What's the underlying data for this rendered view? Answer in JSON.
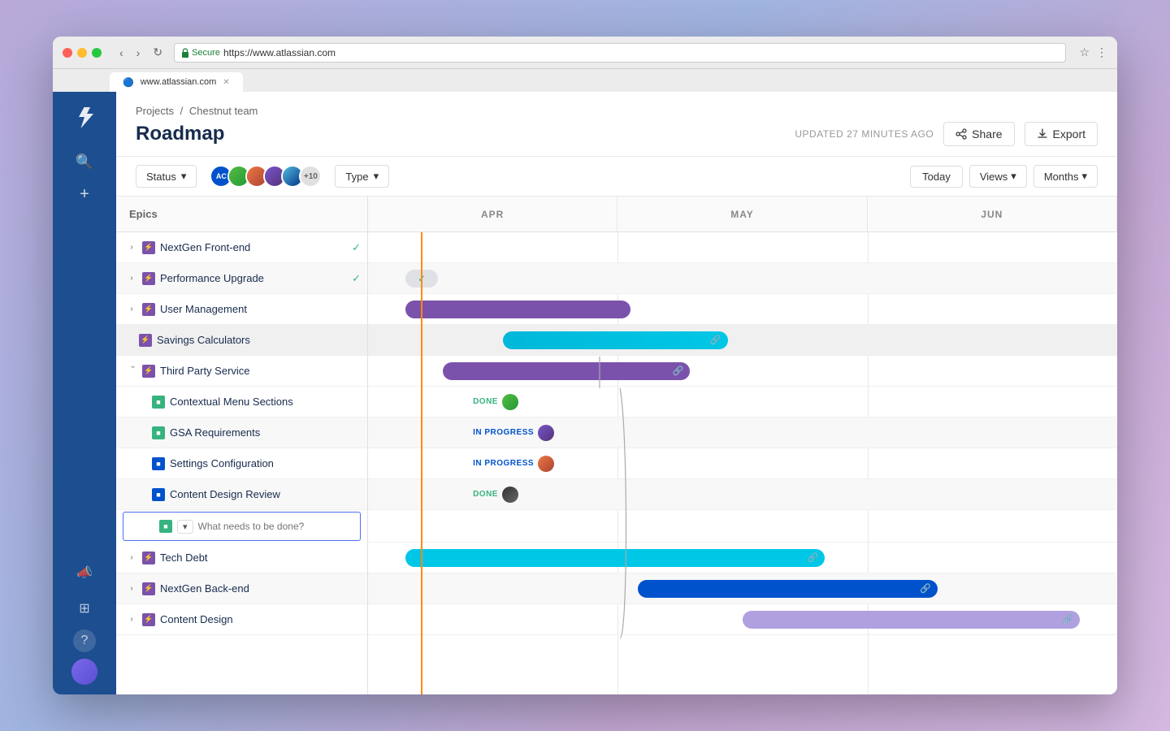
{
  "browser": {
    "url": "https://www.atlassian.com",
    "secure_text": "Secure",
    "tab_label": "www.atlassian.com"
  },
  "breadcrumb": {
    "projects": "Projects",
    "separator": "/",
    "team": "Chestnut team"
  },
  "page": {
    "title": "Roadmap",
    "updated": "UPDATED 27 MINUTES AGO",
    "share_label": "Share",
    "export_label": "Export"
  },
  "toolbar": {
    "status_label": "Status",
    "type_label": "Type",
    "today_label": "Today",
    "views_label": "Views",
    "months_label": "Months",
    "members_extra": "+10"
  },
  "timeline": {
    "months": [
      "APR",
      "MAY",
      "JUN"
    ],
    "epics_header": "Epics"
  },
  "epics": [
    {
      "id": "nextgen-frontend",
      "label": "NextGen Front-end",
      "icon_type": "purple",
      "collapsed": true,
      "check": true,
      "indent": 0
    },
    {
      "id": "performance-upgrade",
      "label": "Performance Upgrade",
      "icon_type": "purple",
      "collapsed": true,
      "check": true,
      "indent": 0
    },
    {
      "id": "user-management",
      "label": "User Management",
      "icon_type": "purple",
      "collapsed": true,
      "check": false,
      "indent": 0
    },
    {
      "id": "savings-calculators",
      "label": "Savings Calculators",
      "icon_type": "purple",
      "collapsed": false,
      "check": false,
      "indent": 1,
      "is_child": true
    },
    {
      "id": "third-party-service",
      "label": "Third Party Service",
      "icon_type": "purple",
      "collapsed": false,
      "check": false,
      "indent": 0,
      "expanded": true
    },
    {
      "id": "contextual-menu",
      "label": "Contextual Menu Sections",
      "icon_type": "green",
      "collapsed": false,
      "check": false,
      "indent": 2,
      "status": "DONE"
    },
    {
      "id": "gsa-requirements",
      "label": "GSA Requirements",
      "icon_type": "green",
      "collapsed": false,
      "check": false,
      "indent": 2,
      "status": "IN PROGRESS"
    },
    {
      "id": "settings-configuration",
      "label": "Settings Configuration",
      "icon_type": "blue",
      "collapsed": false,
      "check": false,
      "indent": 2,
      "status": "IN PROGRESS"
    },
    {
      "id": "content-design-review",
      "label": "Content Design Review",
      "icon_type": "blue",
      "collapsed": false,
      "check": false,
      "indent": 2,
      "status": "DONE"
    },
    {
      "id": "new-item",
      "label": "",
      "placeholder": "What needs to be done?",
      "indent": 2,
      "is_input": true
    },
    {
      "id": "tech-debt",
      "label": "Tech Debt",
      "icon_type": "purple",
      "collapsed": true,
      "check": false,
      "indent": 0
    },
    {
      "id": "nextgen-backend",
      "label": "NextGen Back-end",
      "icon_type": "purple",
      "collapsed": true,
      "check": false,
      "indent": 0
    },
    {
      "id": "content-design",
      "label": "Content Design",
      "icon_type": "purple",
      "collapsed": true,
      "check": false,
      "indent": 0
    }
  ],
  "colors": {
    "sidebar_bg": "#1d4e8f",
    "accent_purple": "#7b52ab",
    "accent_blue": "#0052cc",
    "accent_teal": "#00b8d9",
    "accent_cyan": "#00c7e6",
    "done_green": "#36b37e",
    "today_orange": "#ff8b00"
  },
  "sidebar": {
    "items": [
      {
        "id": "logo",
        "icon": "✦",
        "label": "Home"
      },
      {
        "id": "search",
        "icon": "⌕",
        "label": "Search"
      },
      {
        "id": "create",
        "icon": "+",
        "label": "Create"
      }
    ],
    "bottom_items": [
      {
        "id": "notifications",
        "icon": "🔔",
        "label": "Notifications"
      },
      {
        "id": "apps",
        "icon": "⊞",
        "label": "Apps"
      },
      {
        "id": "help",
        "icon": "?",
        "label": "Help"
      }
    ]
  }
}
